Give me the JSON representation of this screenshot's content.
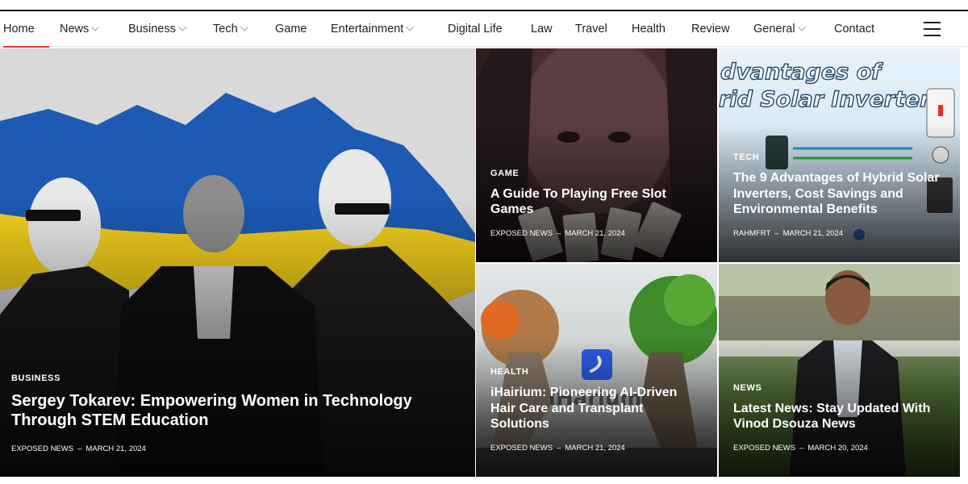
{
  "nav": {
    "items": [
      {
        "label": "Home",
        "active": true,
        "dropdown": false
      },
      {
        "label": "News",
        "active": false,
        "dropdown": true
      },
      {
        "label": "Business",
        "active": false,
        "dropdown": true
      },
      {
        "label": "Tech",
        "active": false,
        "dropdown": true
      },
      {
        "label": "Game",
        "active": false,
        "dropdown": false
      },
      {
        "label": "Entertainment",
        "active": false,
        "dropdown": true
      },
      {
        "label": "Digital Life",
        "active": false,
        "dropdown": false
      },
      {
        "label": "Law",
        "active": false,
        "dropdown": false
      },
      {
        "label": "Travel",
        "active": false,
        "dropdown": false
      },
      {
        "label": "Health",
        "active": false,
        "dropdown": false
      },
      {
        "label": "Review",
        "active": false,
        "dropdown": false
      },
      {
        "label": "General",
        "active": false,
        "dropdown": true
      },
      {
        "label": "Contact",
        "active": false,
        "dropdown": false
      }
    ],
    "menu_icon": "hamburger-menu-icon",
    "active_color": "#e03030"
  },
  "posts": [
    {
      "category": "BUSINESS",
      "title": "Sergey Tokarev: Empowering Women in Technology Through STEM Education",
      "author": "EXPOSED NEWS",
      "sep": "–",
      "date": "MARCH 21, 2024"
    },
    {
      "category": "GAME",
      "title": "A Guide To Playing Free Slot Games",
      "author": "EXPOSED NEWS",
      "sep": "–",
      "date": "MARCH 21, 2024"
    },
    {
      "category": "TECH",
      "title": "The 9 Advantages of Hybrid Solar Inverters, Cost Savings and Environmental Benefits",
      "author": "RAHMFRT",
      "sep": "–",
      "date": "MARCH 21, 2024"
    },
    {
      "category": "HEALTH",
      "title": "iHairium: Pioneering AI-Driven Hair Care and Transplant Solutions",
      "author": "EXPOSED NEWS",
      "sep": "–",
      "date": "MARCH 21, 2024"
    },
    {
      "category": "NEWS",
      "title": "Latest News: Stay Updated With Vinod Dsouza News",
      "author": "EXPOSED NEWS",
      "sep": "–",
      "date": "MARCH 20, 2024"
    }
  ],
  "images": {
    "solar_banner": "dvantages of rid Solar Inverters",
    "hairium_logo": "iHarium"
  }
}
